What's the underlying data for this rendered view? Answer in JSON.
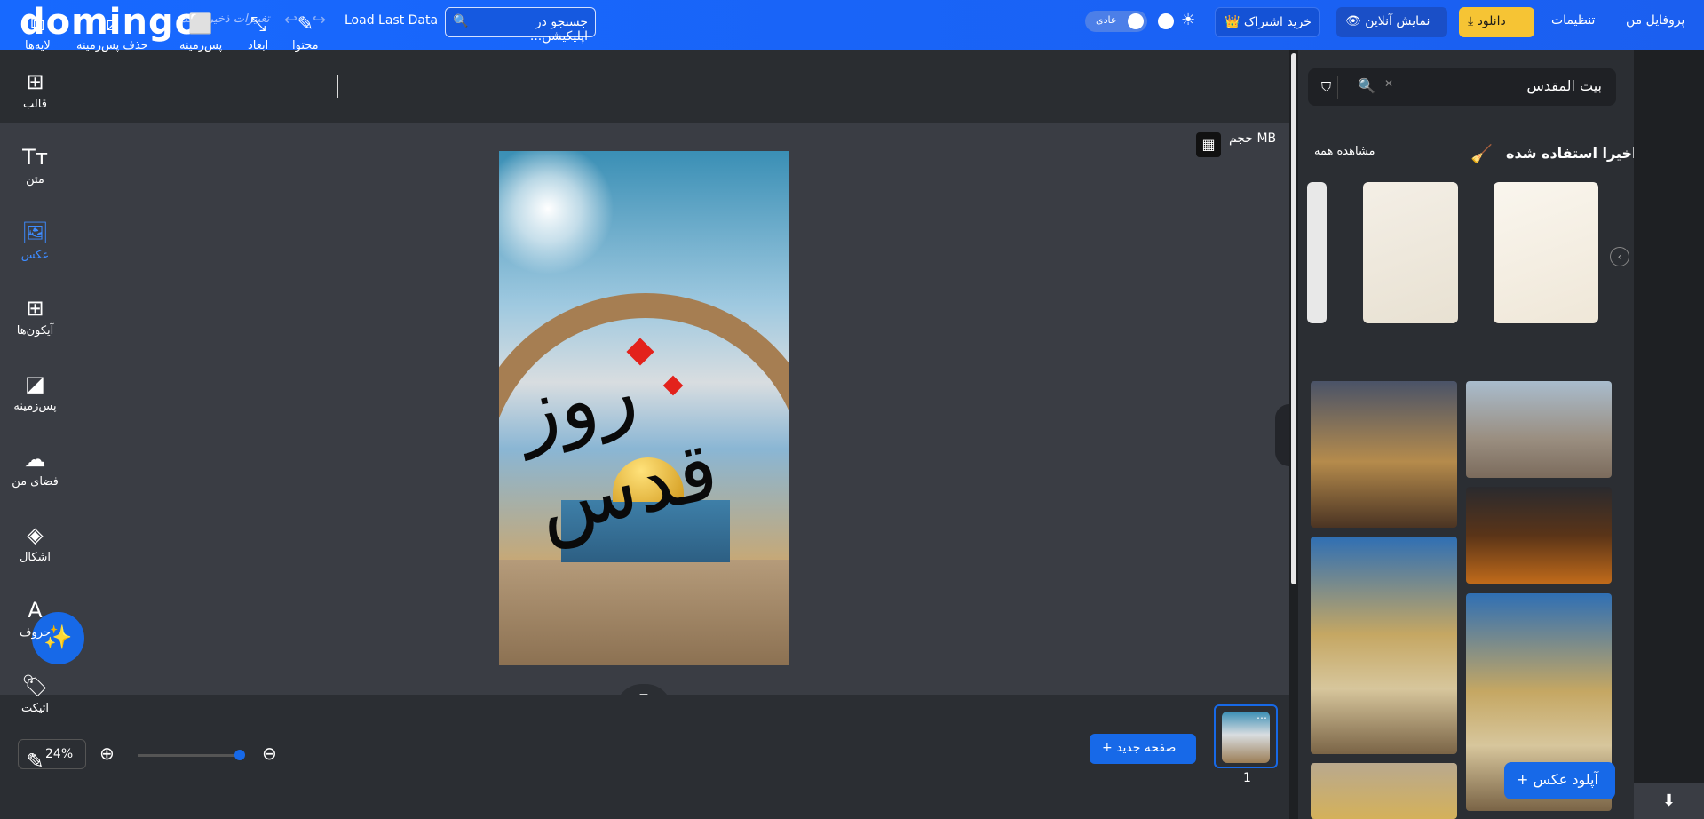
{
  "header": {
    "logo": "domingo",
    "saved_status": "تغییرات ذخیره شد",
    "load_last": "Load Last Data",
    "search_placeholder": "جستجو در اپلیکیشن...",
    "theme_mode": "عادی",
    "buy_sub": "خرید اشتراک",
    "online_view": "نمایش آنلاین",
    "download": "دانلود",
    "settings": "تنظیمات",
    "profile": "پروفایل من"
  },
  "toolbar": {
    "layers": "لایه‌ها",
    "remove_bg": "حذف پس‌زمینه",
    "background": "پس‌زمینه",
    "dimensions": "ابعاد",
    "content": "محتوا"
  },
  "canvas": {
    "size_label": "حجم MB",
    "artwork_text": "روز قدس"
  },
  "bottom": {
    "zoom": "24%",
    "new_page": "صفحه جدید",
    "page_number": "1"
  },
  "panel": {
    "search_value": "بیت المقدس",
    "recent_title": "اخیرا استفاده شده",
    "see_all": "مشاهده همه",
    "upload": "آپلود عکس"
  },
  "rail": {
    "items": [
      {
        "label": "قالب",
        "icon": "template-icon"
      },
      {
        "label": "متن",
        "icon": "text-icon"
      },
      {
        "label": "عکس",
        "icon": "photo-icon",
        "active": true
      },
      {
        "label": "آیکون‌ها",
        "icon": "grid-icon"
      },
      {
        "label": "پس‌زمینه",
        "icon": "background-icon"
      },
      {
        "label": "فضای من",
        "icon": "cloud-upload-icon"
      },
      {
        "label": "اشکال",
        "icon": "shapes-icon"
      },
      {
        "label": "حروف",
        "icon": "font-icon"
      },
      {
        "label": "اتیکت",
        "icon": "tag-icon"
      }
    ]
  },
  "colors": {
    "brand_blue": "#1769e8",
    "download_yellow": "#f6c434",
    "active_rail": "#3d8bff"
  }
}
